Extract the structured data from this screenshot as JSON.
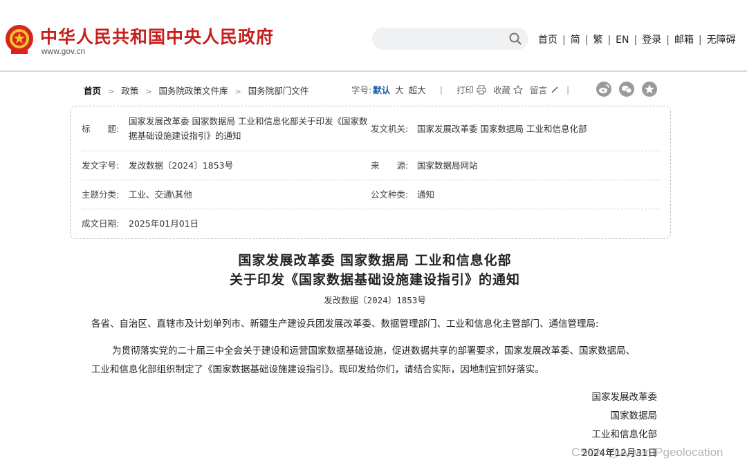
{
  "header": {
    "site_title": "中华人民共和国中央人民政府",
    "site_domain": "www.gov.cn",
    "search_placeholder": "",
    "links": [
      "首页",
      "简",
      "繁",
      "EN",
      "登录",
      "邮箱",
      "无障碍"
    ]
  },
  "breadcrumb": [
    "首页",
    "政策",
    "国务院政策文件库",
    "国务院部门文件"
  ],
  "tools": {
    "font_label": "字号:",
    "font_default": "默认",
    "font_large": "大",
    "font_xlarge": "超大",
    "print": "打印",
    "favorite": "收藏",
    "comment": "留言"
  },
  "share_icons": [
    "weibo-icon",
    "wechat-icon",
    "star-icon"
  ],
  "info": {
    "title_label": "标　　题:",
    "title_line1": "国家发展改革委 国家数据局 工业和信息化部关于印发《国家数",
    "title_line2": "据基础设施建设指引》的通知",
    "issuer_label": "发文机关:",
    "issuer": "国家发展改革委 国家数据局 工业和信息化部",
    "docno_label": "发文字号:",
    "docno": "发改数据〔2024〕1853号",
    "source_label": "来　　源:",
    "source": "国家数据局网站",
    "category_label": "主题分类:",
    "category": "工业、交通\\其他",
    "type_label": "公文种类:",
    "type": "通知",
    "date_label": "成文日期:",
    "date": "2025年01月01日"
  },
  "article": {
    "title_line1": "国家发展改革委 国家数据局 工业和信息化部",
    "title_line2": "关于印发《国家数据基础设施建设指引》的通知",
    "doc_no": "发改数据〔2024〕1853号",
    "salutation": "各省、自治区、直辖市及计划单列市、新疆生产建设兵团发展改革委、数据管理部门、工业和信息化主管部门、通信管理局:",
    "body_line1": "为贯彻落实党的二十届三中全会关于建设和运营国家数据基础设施，促进数据共享的部署要求，国家发展改革委、国家数据局、",
    "body_line2": "工业和信息化部组织制定了《国家数据基础设施建设指引》。现印发给你们，请结合实际，因地制宜抓好落实。",
    "signatures": [
      "国家发展改革委",
      "国家数据局",
      "工业和信息化部"
    ],
    "sign_date": "2024年12月31日"
  },
  "watermark": "CSDN @AiwenIPgeolocation",
  "colors": {
    "brand_red": "#c81e1e",
    "link_blue": "#1a5aa8"
  }
}
